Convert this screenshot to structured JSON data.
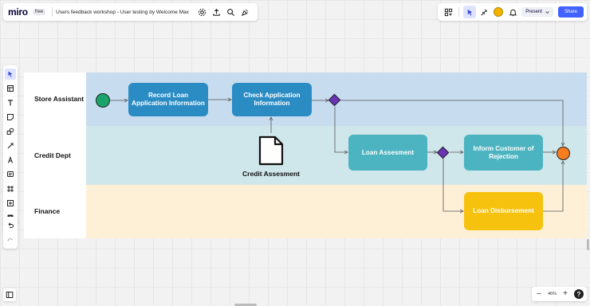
{
  "app": {
    "logo": "miro",
    "plan_badge": "free",
    "board_title": "Users feedback workshop - User testing by Welcome Max"
  },
  "toolbar": {
    "present_label": "Present",
    "share_label": "Share"
  },
  "zoom": {
    "minus": "–",
    "level": "46%",
    "plus": "+",
    "help": "?"
  },
  "diagram": {
    "lanes": [
      {
        "label": "Store Assistant"
      },
      {
        "label": "Credit Dept"
      },
      {
        "label": "Finance"
      }
    ],
    "tasks": {
      "record": "Record Loan Application Information",
      "check": "Check Application Information",
      "loan_assessment": "Loan Assesment",
      "inform": "Inform Customer of Rejection",
      "disbursement": "Loan Disbursement"
    },
    "document_caption": "Credit Assesment"
  },
  "colors": {
    "store_lane": "#c8dcef",
    "credit_lane": "#cfe6ea",
    "finance_lane": "#fdf0d6",
    "task_blue": "#2b8cc4",
    "task_teal": "#4cb4c0",
    "task_yellow": "#f7c20e",
    "start_event": "#1aa46b",
    "end_event": "#f57c1f",
    "gateway": "#6a34b5",
    "share_button": "#4262ff"
  }
}
